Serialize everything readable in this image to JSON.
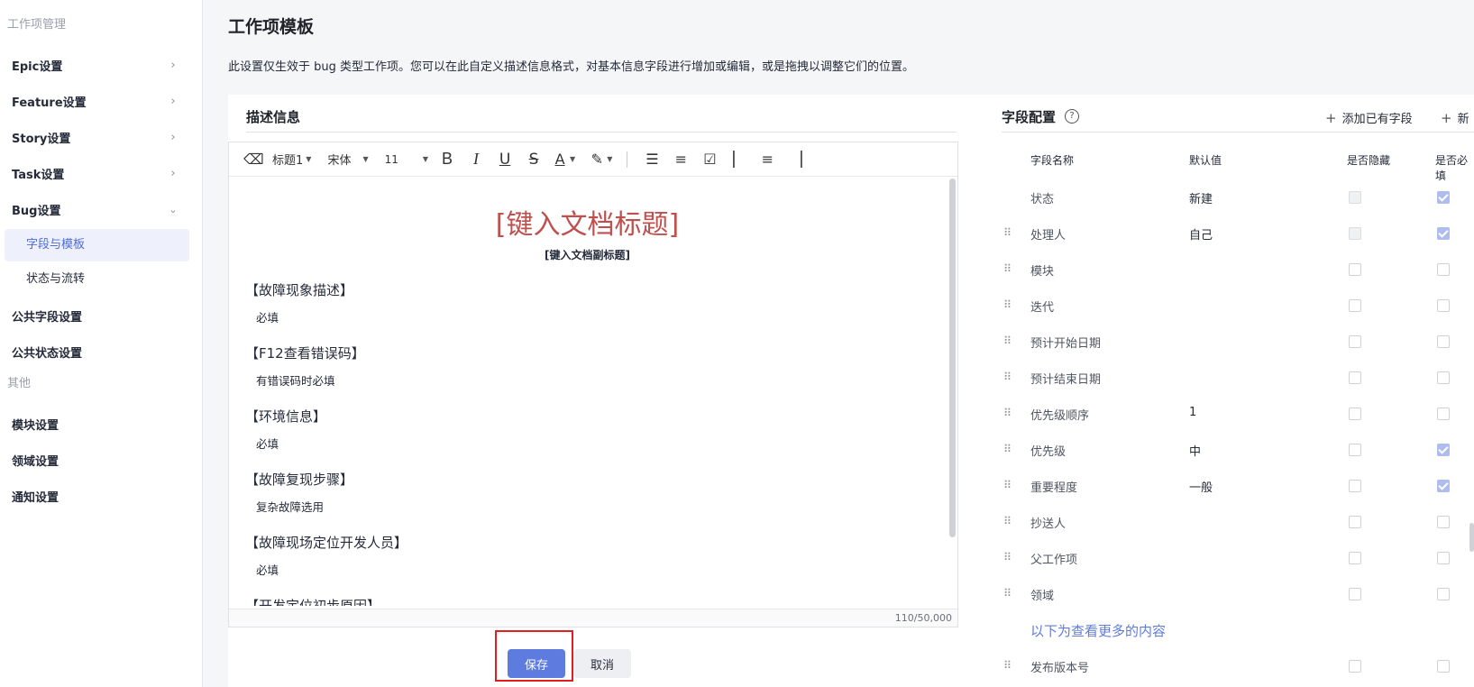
{
  "sidebar": {
    "section_work_items": "工作项管理",
    "items": [
      {
        "label": "Epic设置"
      },
      {
        "label": "Feature设置"
      },
      {
        "label": "Story设置"
      },
      {
        "label": "Task设置"
      },
      {
        "label": "Bug设置"
      }
    ],
    "bug_sub_items": [
      {
        "label": "字段与模板",
        "active": true
      },
      {
        "label": "状态与流转",
        "active": false
      }
    ],
    "public_items": [
      {
        "label": "公共字段设置"
      },
      {
        "label": "公共状态设置"
      }
    ],
    "section_other": "其他",
    "other_items": [
      {
        "label": "模块设置"
      },
      {
        "label": "领域设置"
      },
      {
        "label": "通知设置"
      }
    ]
  },
  "page": {
    "title": "工作项模板",
    "description": "此设置仅生效于 bug 类型工作项。您可以在此自定义描述信息格式，对基本信息字段进行增加或编辑，或是拖拽以调整它们的位置。"
  },
  "editor": {
    "section_title": "描述信息",
    "toolbar": {
      "heading": "标题1",
      "font": "宋体",
      "font_size": "11"
    },
    "doc_title": "[键入文档标题]",
    "doc_subtitle": "[键入文档副标题]",
    "blocks": [
      {
        "heading": "【故障现象描述】",
        "note": "必填"
      },
      {
        "heading": "【F12查看错误码】",
        "note": "有错误码时必填"
      },
      {
        "heading": "【环境信息】",
        "note": "必填"
      },
      {
        "heading": "【故障复现步骤】",
        "note": "复杂故障选用"
      },
      {
        "heading": "【故障现场定位开发人员】",
        "note": "必填"
      },
      {
        "heading": "【开发定位初步原因】",
        "note": ""
      }
    ],
    "char_counter": "110/50,000",
    "save_label": "保存",
    "cancel_label": "取消"
  },
  "field_config": {
    "section_title": "字段配置",
    "add_existing_label": "添加已有字段",
    "add_new_label": "新",
    "columns": {
      "name": "字段名称",
      "default": "默认值",
      "hidden": "是否隐藏",
      "required": "是否必填"
    },
    "rows": [
      {
        "name": "状态",
        "default": "新建",
        "hidden": false,
        "hidden_disabled": true,
        "required": true,
        "draggable": false
      },
      {
        "name": "处理人",
        "default": "自己",
        "hidden": false,
        "hidden_disabled": true,
        "required": true,
        "draggable": true
      },
      {
        "name": "模块",
        "default": "",
        "hidden": false,
        "hidden_disabled": false,
        "required": false,
        "draggable": true
      },
      {
        "name": "迭代",
        "default": "",
        "hidden": false,
        "hidden_disabled": false,
        "required": false,
        "draggable": true
      },
      {
        "name": "预计开始日期",
        "default": "",
        "hidden": false,
        "hidden_disabled": false,
        "required": false,
        "draggable": true
      },
      {
        "name": "预计结束日期",
        "default": "",
        "hidden": false,
        "hidden_disabled": false,
        "required": false,
        "draggable": true
      },
      {
        "name": "优先级顺序",
        "default": "1",
        "hidden": false,
        "hidden_disabled": false,
        "required": false,
        "draggable": true
      },
      {
        "name": "优先级",
        "default": "中",
        "hidden": false,
        "hidden_disabled": false,
        "required": true,
        "draggable": true
      },
      {
        "name": "重要程度",
        "default": "一般",
        "hidden": false,
        "hidden_disabled": false,
        "required": true,
        "draggable": true
      },
      {
        "name": "抄送人",
        "default": "",
        "hidden": false,
        "hidden_disabled": false,
        "required": false,
        "draggable": true
      },
      {
        "name": "父工作项",
        "default": "",
        "hidden": false,
        "hidden_disabled": false,
        "required": false,
        "draggable": true
      },
      {
        "name": "领域",
        "default": "",
        "hidden": false,
        "hidden_disabled": false,
        "required": false,
        "draggable": true
      }
    ],
    "more_label": "以下为查看更多的内容",
    "extra_rows": [
      {
        "name": "发布版本号",
        "default": "",
        "hidden": false,
        "hidden_disabled": false,
        "required": false,
        "draggable": true
      }
    ]
  }
}
